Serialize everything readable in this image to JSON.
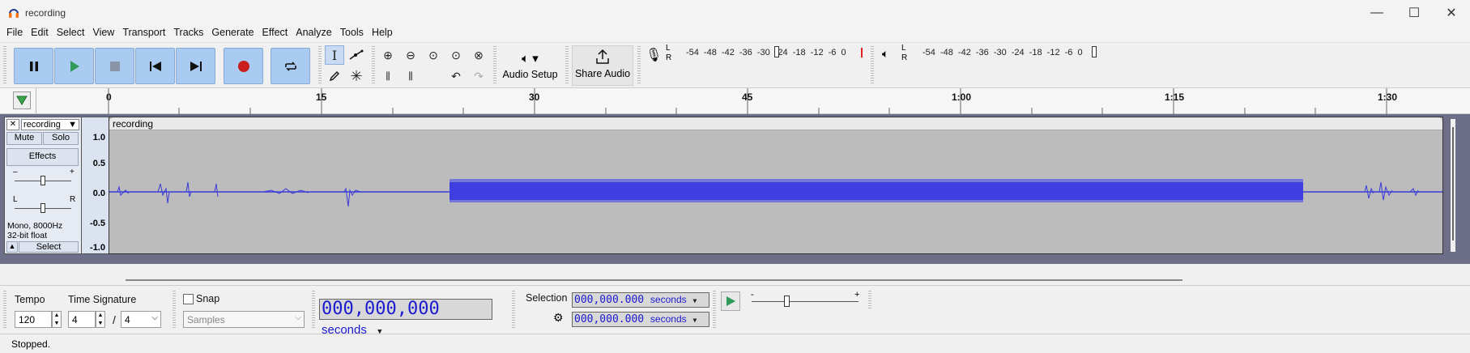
{
  "window": {
    "title": "recording",
    "minimize_glyph": "—",
    "maximize_glyph": "☐",
    "close_glyph": "✕"
  },
  "menu": [
    "File",
    "Edit",
    "Select",
    "View",
    "Transport",
    "Tracks",
    "Generate",
    "Effect",
    "Analyze",
    "Tools",
    "Help"
  ],
  "toolbar": {
    "transport_icons": [
      "pause-icon",
      "play-icon",
      "stop-icon",
      "skip-to-start-icon",
      "skip-to-end-icon",
      "record-icon",
      "loop-icon"
    ],
    "audio_setup_label": "Audio Setup",
    "share_audio_label": "Share Audio",
    "meter_lr": {
      "l": "L",
      "r": "R"
    },
    "record_meter_scale": "-54 -48 -42 -36 -30 -24 -18 -12 -6 0",
    "play_meter_scale": "-54 -48 -42 -36 -30 -24 -18 -12 -6 0"
  },
  "ruler": {
    "ticks": [
      "0",
      "15",
      "30",
      "45",
      "1:00",
      "1:15",
      "1:30"
    ]
  },
  "track": {
    "name": "recording",
    "close_glyph": "✕",
    "mute": "Mute",
    "solo": "Solo",
    "effects": "Effects",
    "gain_minus": "–",
    "gain_plus": "+",
    "pan_l": "L",
    "pan_r": "R",
    "format_line1": "Mono, 8000Hz",
    "format_line2": "32-bit float",
    "select": "Select",
    "clip_name": "recording",
    "scale": [
      "1.0",
      "0.5",
      "0.0",
      "-0.5",
      "-1.0"
    ]
  },
  "bottom": {
    "tempo_label": "Tempo",
    "tempo_value": "120",
    "timesig_label": "Time Signature",
    "timesig_num": "4",
    "timesig_slash": "/",
    "timesig_den": "4",
    "snap_label": "Snap",
    "snap_value": "Samples",
    "time_digits": "000,000,000",
    "time_units": "seconds",
    "selection_label": "Selection",
    "sel_start_digits": "000,000.000",
    "sel_end_digits": "000,000.000",
    "sel_units": "seconds",
    "speed_minus": "-",
    "speed_plus": "+"
  },
  "status": {
    "text": "Stopped."
  },
  "colors": {
    "waveform": "#3f3fe0",
    "transport_bg": "#aacbf1",
    "track_bg": "#6c6f87",
    "digits": "#1a1ad0"
  }
}
